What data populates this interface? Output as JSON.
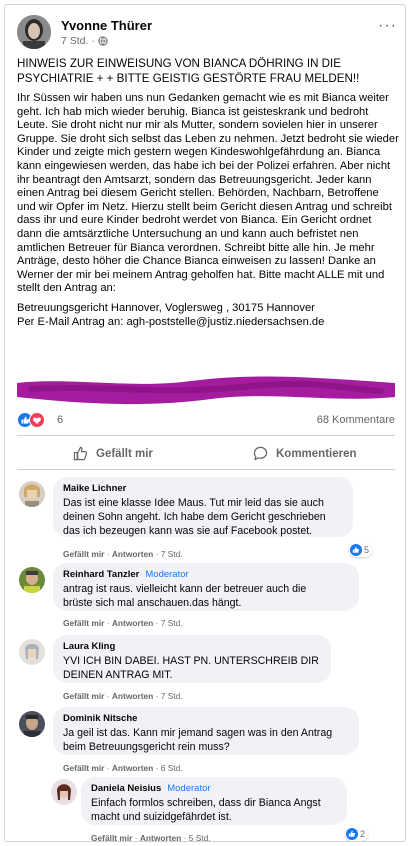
{
  "post": {
    "author": "Yvonne Thürer",
    "time": "7 Std.",
    "more_label": "···",
    "headline": "HINWEIS ZUR EINWEISUNG VON BIANCA DÖHRING IN DIE PSYCHIATRIE + + BITTE GEISTIG GESTÖRTE FRAU MELDEN!!",
    "body": "Ihr Süssen wir haben uns nun Gedanken gemacht wie es mit Bianca weiter geht. Ich hab mich wieder beruhig. Bianca ist geisteskrank und bedroht Leute. Sie droht nicht nur mir als Mutter, sondern sovielen hier in unserer Gruppe. Sie droht sich selbst das Leben zu nehmen. Jetzt bedroht sie wieder Kinder und zeigte mich gestern wegen Kindeswohlgefährdung an. Bianca kann eingewiesen werden, das habe ich bei der Polizei erfahren. Aber nicht ihr beantragt den Amtsarzt, sondern das Betreuungsgericht. Jeder kann einen Antrag bei diesem Gericht stellen. Behörden, Nachbarn, Betroffene und wir Opfer im Netz. Hierzu stellt beim Gericht diesen Antrag und schreibt dass ihr und eure Kinder bedroht werdet von Bianca. Ein Gericht ordnet dann die amtsärztliche Untersuchung an und kann auch befristet nen amtlichen Betreuer für Bianca verordnen. Schreibt bitte alle hin. Je mehr Anträge, desto höher die Chance Bianca einweisen zu lassen! Danke an Werner der mir bei meinem Antrag geholfen hat. Bitte macht ALLE mit und stellt den Antrag an:",
    "address": "Betreuungsgericht Hannover, Voglersweg , 30175 Hannover\nPer E-Mail Antrag an: agh-poststelle@justiz.niedersachsen.de",
    "reaction_count": "6",
    "comment_count": "68 Kommentare",
    "like_action": "Gefällt mir",
    "comment_action": "Kommentieren"
  },
  "comment_actions": {
    "like": "Gefällt mir",
    "reply": "Antworten",
    "sep": " · "
  },
  "comments": [
    {
      "name": "Maike Lichner",
      "badge": "",
      "text": "Das ist eine klasse Idee Maus. Tut mir leid das sie auch\ndeinen Sohn angeht. Ich habe dem Gericht geschrieben\ndas ich bezeugen kann was sie auf Facebook postet.",
      "time": "7 Std.",
      "likes": "5"
    },
    {
      "name": "Reinhard Tanzler",
      "badge": "Moderator",
      "text": "antrag ist raus. vielleicht kann der betreuer auch die\nbrüste sich mal anschauen.das hängt.",
      "time": "7 Std.",
      "likes": ""
    },
    {
      "name": "Laura Kling",
      "badge": "",
      "text": "YVI ICH BIN DABEI. HAST PN. UNTERSCHREIB DIR\nDEINEN ANTRAG MIT.",
      "time": "7 Std.",
      "likes": ""
    },
    {
      "name": "Dominik Nitsche",
      "badge": "",
      "text": "Ja geil ist das. Kann mir jemand sagen was in den Antrag\nbeim Betreuungsgericht rein muss?",
      "time": "6 Std.",
      "likes": ""
    },
    {
      "name": "Daniela Neisius",
      "badge": "Moderator",
      "text": "Einfach formlos schreiben, dass dir Bianca Angst\nmacht und suizidgefährdet ist.",
      "time": "5 Std.",
      "likes": "2"
    }
  ],
  "colors": {
    "accent": "#1877f2",
    "redaction": "#a61c9e",
    "muted": "#65676b",
    "bubble": "#f0f2f5"
  },
  "icons": {
    "globe": "globe-icon",
    "like": "thumbs-up-icon",
    "comment": "speech-bubble-icon",
    "love": "heart-icon"
  }
}
